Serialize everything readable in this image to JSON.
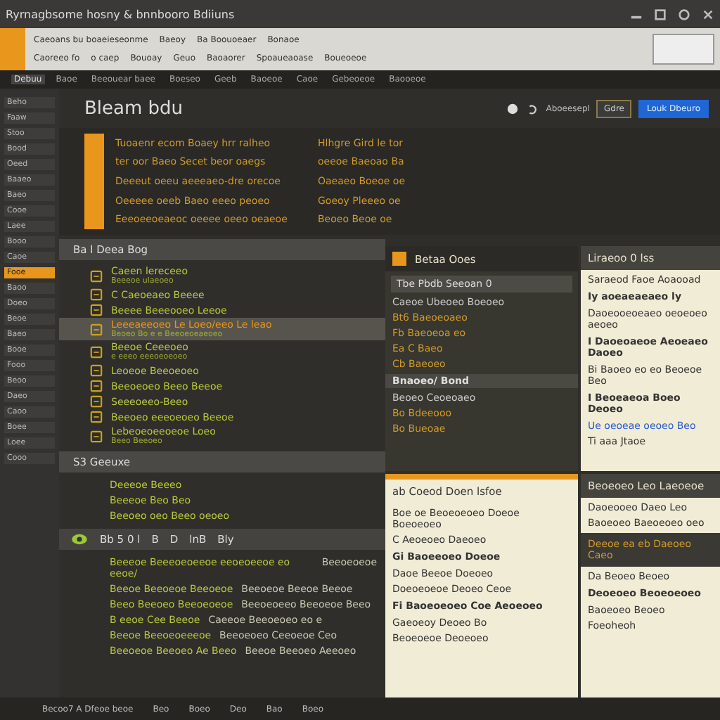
{
  "title_bar": {
    "title": "Ryrnagbsome hosny & bnnbooro Bdiiuns"
  },
  "toolbar": {
    "menu": [
      "Caeoans bu boaeieseonme",
      "Baeoy",
      "Ba Boouoeaer",
      "Bonaoe"
    ],
    "options": [
      "Caoreeo fo",
      "o caep",
      "Bouoay",
      "Geuo",
      "Baoaorer",
      "Spoaueaoase",
      "Boueoeoe"
    ]
  },
  "tabs": [
    {
      "label": "Debuu",
      "selected": true
    },
    {
      "label": "Baoe",
      "selected": false
    },
    {
      "label": "Beeouear baee",
      "selected": false
    },
    {
      "label": "Boeseo",
      "selected": false
    },
    {
      "label": "Geeb",
      "selected": false
    },
    {
      "label": "Baoeoe",
      "selected": false
    },
    {
      "label": "Caoe",
      "selected": false
    },
    {
      "label": "Gebeoeoe",
      "selected": false
    },
    {
      "label": "Baooeoe",
      "selected": false
    }
  ],
  "sidebar": {
    "items": [
      {
        "label": "Beho",
        "selected": false
      },
      {
        "label": "Faaw",
        "selected": false
      },
      {
        "label": "Stoo",
        "selected": false
      },
      {
        "label": "Bood",
        "selected": false
      },
      {
        "label": "Oeed",
        "selected": false
      },
      {
        "label": "Baaeo",
        "selected": false
      },
      {
        "label": "Baeo",
        "selected": false
      },
      {
        "label": "Cooe",
        "selected": false
      },
      {
        "label": "Laee",
        "selected": false
      },
      {
        "label": "Booo",
        "selected": false
      },
      {
        "label": "Caoe",
        "selected": false
      },
      {
        "label": "Fooe",
        "selected": true
      },
      {
        "label": "Baoo",
        "selected": false
      },
      {
        "label": "Doeo",
        "selected": false
      },
      {
        "label": "Beoe",
        "selected": false
      },
      {
        "label": "Baeo",
        "selected": false
      },
      {
        "label": "Booe",
        "selected": false
      },
      {
        "label": "Fooo",
        "selected": false
      },
      {
        "label": "Beoo",
        "selected": false
      },
      {
        "label": "Daeo",
        "selected": false
      },
      {
        "label": "Caoo",
        "selected": false
      },
      {
        "label": "Boee",
        "selected": false
      },
      {
        "label": "Loee",
        "selected": false
      },
      {
        "label": "Cooo",
        "selected": false
      }
    ]
  },
  "header": {
    "title": "Bleam bdu",
    "link": "Aboeesepl",
    "button_1": "Gdre",
    "button_2": "Louk Dbeuro"
  },
  "code": {
    "lines": [
      [
        "Tuoaenr ecom  Boaey hrr ralheo",
        "Hlhgre Gird le tor"
      ],
      [
        "ter oor Baeo  Secet beor oaegs",
        "oeeoe Baeoao  Ba"
      ],
      [
        "Deeeut oeeu aeeeaeo-dre orecoe",
        "Oaeaeo Boeoe oe"
      ],
      [
        "Oeeeee oeeb  Baeo eeeo peoeo",
        "Goeoy Pleeeo oe"
      ],
      [
        "Eeeoeeoeaeoc oeeee oeeo oeaeoe",
        "Beoeo Beoe oe"
      ]
    ]
  },
  "section_1": {
    "title": "Ba l Deea Bog",
    "rows": [
      {
        "text": "Caeen lereceeo",
        "sub": "Beeeoe ulaeoeo",
        "selected": false
      },
      {
        "text": "C Caeoeaeo Beeee",
        "sub": "",
        "selected": false
      },
      {
        "text": "Beeee Beeeooeo Leeoe",
        "sub": "",
        "selected": false
      },
      {
        "text": "Leeeaeeoeo Le Loeo/eeo Le leao",
        "sub": "Beoeo Bo e e Beeoeoeaeoeo",
        "selected": true
      },
      {
        "text": "Beeoe  Ceeeoeo",
        "sub": "e eeeo eeeoeoeoeo",
        "selected": false
      },
      {
        "text": "Leoeoe  Beeoeoeo",
        "sub": "",
        "selected": false
      },
      {
        "text": "Beeoeoeo  Beeo Beeoe",
        "sub": "",
        "selected": false
      },
      {
        "text": "Seeeoeeo-Beeo",
        "sub": "",
        "selected": false
      },
      {
        "text": "Beeoeo eeeoeoeo Beeoe",
        "sub": "",
        "selected": false
      },
      {
        "text": "Lebeoeoeeoeoe Loeo",
        "sub": "Beeo Beeoeo",
        "selected": false
      }
    ]
  },
  "section_2": {
    "title": "S3 Geeuxe",
    "rows": [
      {
        "text": "Deeeoe  Beeeo"
      },
      {
        "text": "Beeeoe  Beo Beo"
      },
      {
        "text": "Beeoeo oeo  Beeo oeoeo"
      }
    ]
  },
  "mini_toolbar": {
    "items": [
      "Bb 5 0 l",
      "B",
      "D",
      "lnB",
      "Bly"
    ]
  },
  "section_3": {
    "rows": [
      [
        "Beeeoe Beeeoeoeeoe eeoeoeeoe eo eeoe/",
        "Beeoeoeoe"
      ],
      [
        "Beeoe Beeoeoe Beeoeoe",
        "Beeoeoe Beeoe Beeoe"
      ],
      [
        "Beeo Beeoeo  Beeoeoeoe",
        "Beeoeoeeo Beeoeoe Beeo"
      ],
      [
        "B eeoe Cee Beeoe",
        "Caeeoe Beeoeoeo eo e"
      ],
      [
        "Beeoe Beeoeoeeeoe",
        "Beeoeoeo Ceeoeoe  Ceo"
      ],
      [
        "Beeoeoe Beeoeo Ae Beeo",
        "Beeoe Beeoeo Aeeoeo"
      ]
    ]
  },
  "panels": [
    {
      "kind": "dark",
      "title": "Betaa Ooes",
      "lines": [
        {
          "kind": "field",
          "text": "Tbe Pbdb Seeoan 0"
        },
        {
          "kind": "text",
          "text": "Caeoe  Ubeoeo Boeoeo"
        },
        {
          "kind": "item",
          "text": "Bt6  Baeoeoaeo"
        },
        {
          "kind": "item",
          "text": "Fb  Baeoeoa eo"
        },
        {
          "kind": "item",
          "text": "Ea  C Baeo"
        },
        {
          "kind": "item",
          "text": "Cb  Baeoeo"
        },
        {
          "kind": "heading",
          "text": "Bnaoeo/  Bond"
        },
        {
          "kind": "text",
          "text": "Beoeo  Ceoeoaeo"
        },
        {
          "kind": "item",
          "text": "Bo  Bdeeooo"
        },
        {
          "kind": "item",
          "text": "Bo  Bueoae"
        }
      ]
    },
    {
      "kind": "light",
      "title": "Liraeoo 0 lss",
      "lines": [
        {
          "kind": "text",
          "text": "Saraeod  Faoe Aoaooad"
        },
        {
          "kind": "heading",
          "text": "Iy aoeaeaeaeo ly"
        },
        {
          "kind": "text",
          "text": "Daoeooeoeaeo oeoeoeo aeoeo"
        },
        {
          "kind": "heading",
          "text": "I Daoeoaeoe  Aeoeaeo Daoeo"
        },
        {
          "kind": "text",
          "text": "Bi Baoeo eo eo Beoeoe Beo"
        },
        {
          "kind": "heading",
          "text": "I Beoeaeoa Boeo Deoeo"
        },
        {
          "kind": "link",
          "text": "Ue oeoeae oeoeo  Beo"
        },
        {
          "kind": "text",
          "text": "Ti  aaa Jtaoe"
        }
      ]
    },
    {
      "kind": "light",
      "title": "ab Coeod Doen lsfoe",
      "lines": [
        {
          "kind": "text",
          "text": "Boe oe Beoeoeoeo Doeoe Boeoeoeo"
        },
        {
          "kind": "text",
          "text": "C Aeoeoeo  Daeoeo"
        },
        {
          "kind": "heading",
          "text": "Gi Baoeeoeo  Doeoe"
        },
        {
          "kind": "text",
          "text": "Daoe Beeoe  Doeoeo"
        },
        {
          "kind": "text",
          "text": "Doeoeoeoe  Deoeo Ceoe"
        },
        {
          "kind": "heading",
          "text": "Fi Baoeoeoeo  Coe Aeoeoeo"
        },
        {
          "kind": "text",
          "text": "Gaeoeoy  Deoeo Bo"
        },
        {
          "kind": "text",
          "text": "Beoeoeoe  Deoeoeo"
        }
      ]
    },
    {
      "kind": "light",
      "title": "Beoeoeo Leo Laeoeoe",
      "lines": [
        {
          "kind": "text",
          "text": "Daoeooeo Daeo Leo"
        },
        {
          "kind": "text",
          "text": "Baoeoeo Baeoeoeo oeo"
        },
        {
          "kind": "band",
          "text": "Deeoe ea eb  Daeoeo  Caeo"
        },
        {
          "kind": "text",
          "text": "Da  Beoeo  Beoeo"
        },
        {
          "kind": "heading",
          "text": "Deoeoeo Beoeoeoeo"
        },
        {
          "kind": "text",
          "text": "Baoeoeo Beoeo"
        },
        {
          "kind": "text",
          "text": "Foeoheoh"
        }
      ]
    }
  ],
  "status_bar": {
    "items": [
      "Becoo7  A  Dfeoe beoe",
      "Beo",
      "Boeo",
      "Deo",
      "Bao",
      "Boeo"
    ]
  }
}
